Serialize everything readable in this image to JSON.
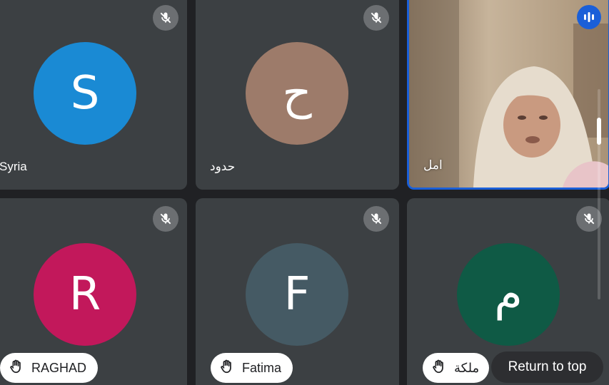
{
  "participants": [
    {
      "name": "Syria",
      "initial": "S",
      "avatar_color": "#1a8ad4",
      "muted": true
    },
    {
      "name": "حدود",
      "initial": "ح",
      "avatar_color": "#9d7b6a",
      "muted": true
    },
    {
      "name": "امل",
      "initial": "",
      "video_on": true,
      "speaking": true
    },
    {
      "name": "RAGHAD",
      "initial": "R",
      "avatar_color": "#c2185b",
      "muted": true,
      "hand_raised": true
    },
    {
      "name": "Fatima",
      "initial": "F",
      "avatar_color": "#455a64",
      "muted": true,
      "hand_raised": true
    },
    {
      "name": "ملكة",
      "initial": "م",
      "avatar_color": "#0f5a45",
      "muted": true,
      "hand_raised": true
    }
  ],
  "controls": {
    "return_to_top": "Return to top"
  },
  "icons": {
    "muted": "mic-off-icon",
    "hand": "raised-hand-icon",
    "speaking": "audio-level-icon"
  },
  "colors": {
    "background": "#202124",
    "tile": "#3c4043",
    "active_speaker_border": "#1a5fd8"
  }
}
